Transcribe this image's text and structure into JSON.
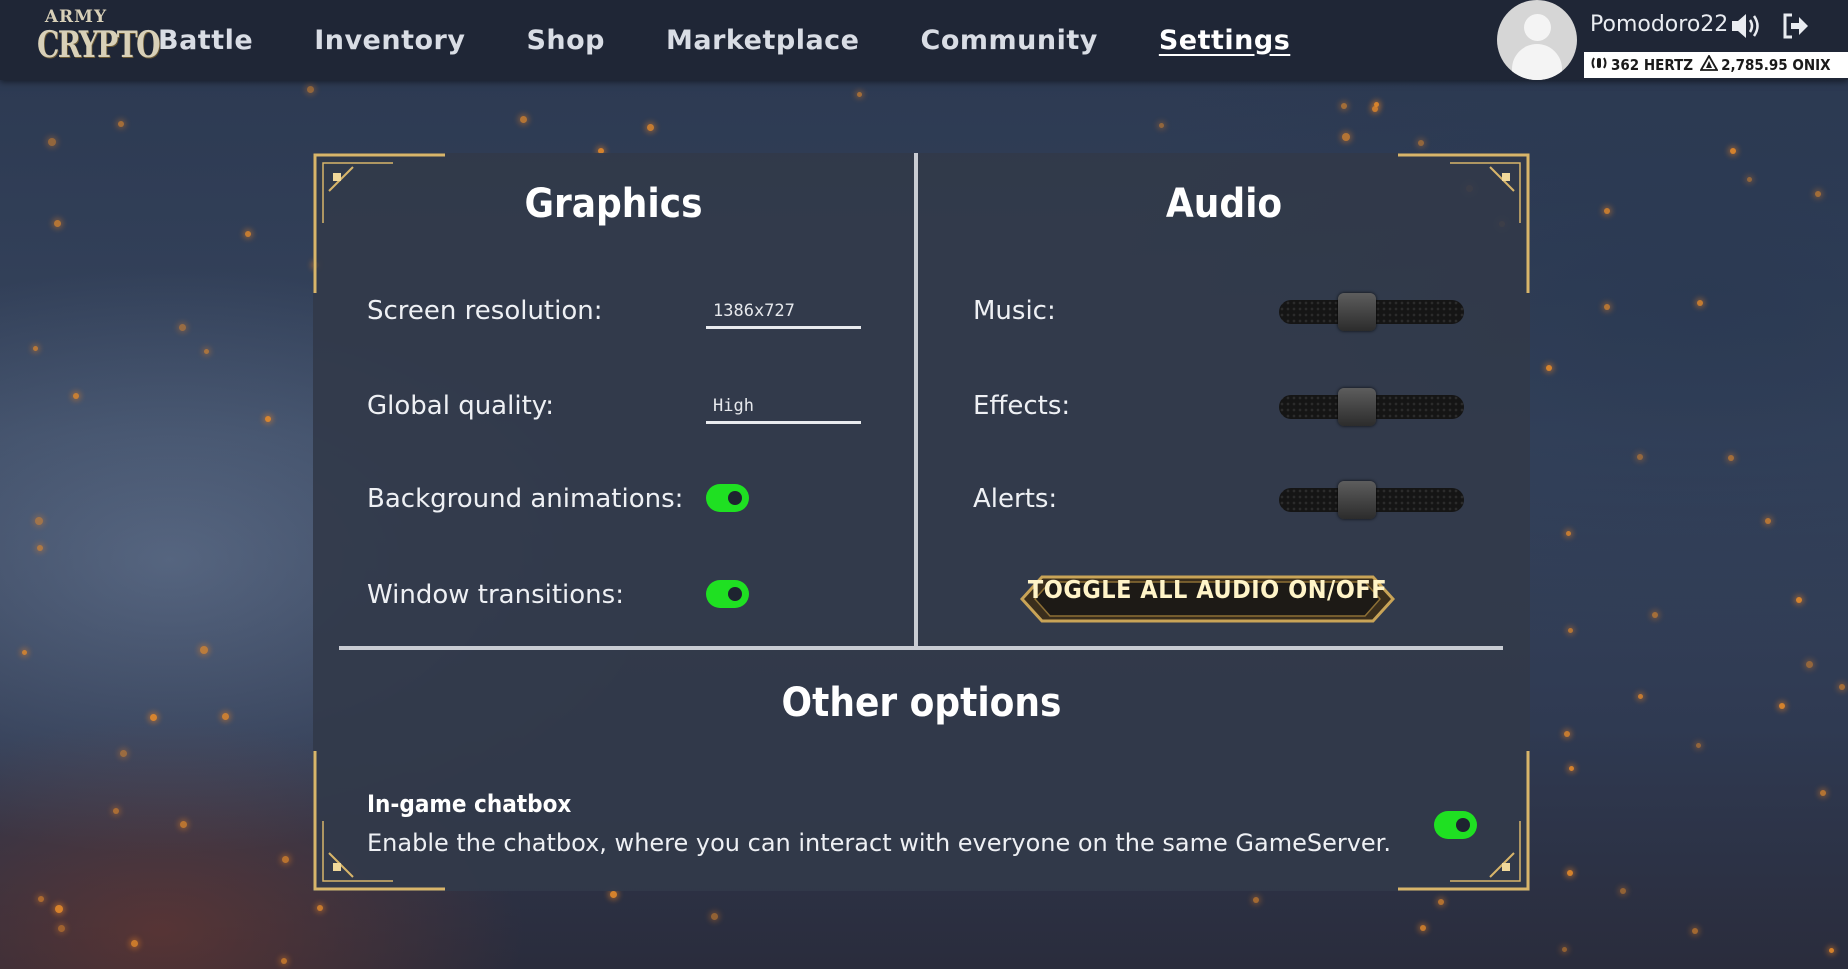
{
  "app": {
    "logo_line1": "ARMY",
    "logo_line2": "CRYPTO"
  },
  "nav": {
    "items": [
      {
        "label": "Battle",
        "active": false
      },
      {
        "label": "Inventory",
        "active": false
      },
      {
        "label": "Shop",
        "active": false
      },
      {
        "label": "Marketplace",
        "active": false
      },
      {
        "label": "Community",
        "active": false
      },
      {
        "label": "Settings",
        "active": true
      }
    ]
  },
  "user": {
    "name": "Pomodoro22",
    "sound_icon": "speaker-icon",
    "logout_icon": "logout-icon",
    "hertz": "362 HERTZ",
    "onix": "2,785.95 ONIX"
  },
  "graphics": {
    "title": "Graphics",
    "screen_resolution_label": "Screen resolution:",
    "screen_resolution_value": "1386x727",
    "global_quality_label": "Global quality:",
    "global_quality_value": "High",
    "background_animations_label": "Background animations:",
    "background_animations_on": true,
    "window_transitions_label": "Window transitions:",
    "window_transitions_on": true
  },
  "audio": {
    "title": "Audio",
    "music_label": "Music:",
    "music_level": 0.4,
    "effects_label": "Effects:",
    "effects_level": 0.4,
    "alerts_label": "Alerts:",
    "alerts_level": 0.4,
    "toggle_all_label": "TOGGLE ALL AUDIO ON/OFF"
  },
  "other": {
    "title": "Other options",
    "chatbox_title": "In-game chatbox",
    "chatbox_desc": "Enable the chatbox, where you can interact with everyone on the same GameServer.",
    "chatbox_on": true
  },
  "colors": {
    "toggle_on": "#1fe022",
    "accent_gold": "#d8b56a",
    "ember": "#e58a2a"
  }
}
